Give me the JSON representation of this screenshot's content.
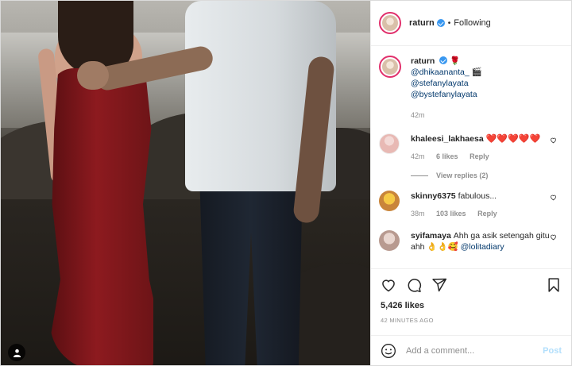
{
  "header": {
    "username": "raturn",
    "separator": "•",
    "follow_status": "Following"
  },
  "caption": {
    "username": "raturn",
    "emoji": "🌹",
    "line1": "@dhikaananta_",
    "line1_emoji": "🎬",
    "line2": "@stefanylayata",
    "line3": "@bystefanylayata",
    "time": "42m"
  },
  "comments": [
    {
      "username": "khaleesi_lakhaesa",
      "text": "❤️❤️❤️❤️❤️",
      "time": "42m",
      "likes": "6 likes",
      "reply": "Reply",
      "view_replies": "View replies (2)"
    },
    {
      "username": "skinny6375",
      "text": "fabulous...",
      "time": "38m",
      "likes": "103 likes",
      "reply": "Reply"
    },
    {
      "username": "syifamaya",
      "text": "Ahh ga asik setengah gitu ahh 👌👌🥰",
      "mention": "@lolitadiary"
    }
  ],
  "actions": {
    "likes": "5,426 likes",
    "posted": "42 MINUTES AGO"
  },
  "composer": {
    "placeholder": "Add a comment...",
    "post_label": "Post"
  },
  "icons": {
    "like": "heart-icon",
    "comment": "comment-icon",
    "share": "share-icon",
    "save": "bookmark-icon",
    "emoji": "emoji-icon",
    "tag": "user-tag-icon"
  },
  "colors": {
    "verified": "#3897f0",
    "story_ring": "#e1306c",
    "link": "#00376b",
    "post_disabled": "#b2dffc"
  }
}
